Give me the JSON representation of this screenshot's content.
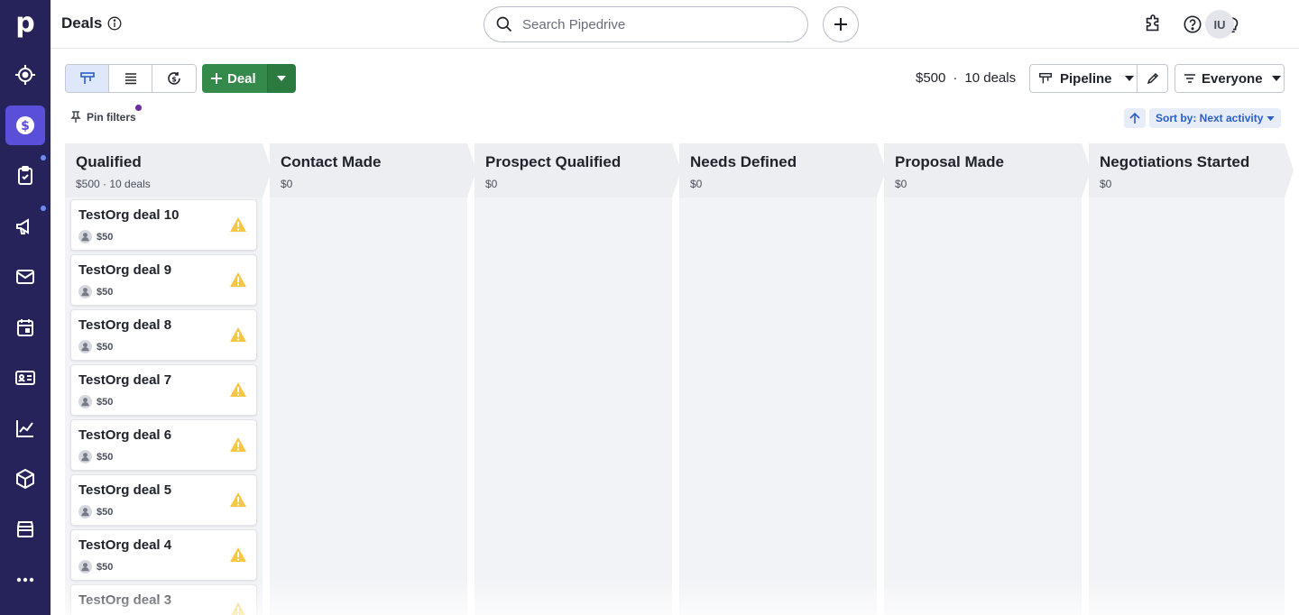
{
  "topbar": {
    "title": "Deals",
    "search_placeholder": "Search Pipedrive",
    "avatar_initials": "IU"
  },
  "toolbar": {
    "add_deal_label": "Deal",
    "summary_value": "$500",
    "summary_separator": "·",
    "summary_count": "10 deals",
    "pipeline_label": "Pipeline",
    "everyone_label": "Everyone",
    "pin_filters_label": "Pin filters",
    "sort_label": "Sort by: Next activity"
  },
  "stages": [
    {
      "name": "Qualified",
      "summary": "$500 · 10 deals"
    },
    {
      "name": "Contact Made",
      "summary": "$0"
    },
    {
      "name": "Prospect Qualified",
      "summary": "$0"
    },
    {
      "name": "Needs Defined",
      "summary": "$0"
    },
    {
      "name": "Proposal Made",
      "summary": "$0"
    },
    {
      "name": "Negotiations Started",
      "summary": "$0"
    }
  ],
  "deals": [
    {
      "title": "TestOrg deal 10",
      "value": "$50"
    },
    {
      "title": "TestOrg deal 9",
      "value": "$50"
    },
    {
      "title": "TestOrg deal 8",
      "value": "$50"
    },
    {
      "title": "TestOrg deal 7",
      "value": "$50"
    },
    {
      "title": "TestOrg deal 6",
      "value": "$50"
    },
    {
      "title": "TestOrg deal 5",
      "value": "$50"
    },
    {
      "title": "TestOrg deal 4",
      "value": "$50"
    },
    {
      "title": "TestOrg deal 3",
      "value": ""
    }
  ],
  "nav_icons": [
    "leads-icon",
    "deals-icon",
    "activities-icon",
    "campaigns-icon",
    "mail-icon",
    "calendar-icon",
    "contacts-icon",
    "insights-icon",
    "products-icon",
    "marketplace-icon",
    "more-icon"
  ],
  "colors": {
    "rail": "#26235a",
    "rail_active": "#5a4fd8",
    "deal_button": "#338a4b",
    "sort_link": "#2a5ec7",
    "warning": "#f6c744"
  }
}
